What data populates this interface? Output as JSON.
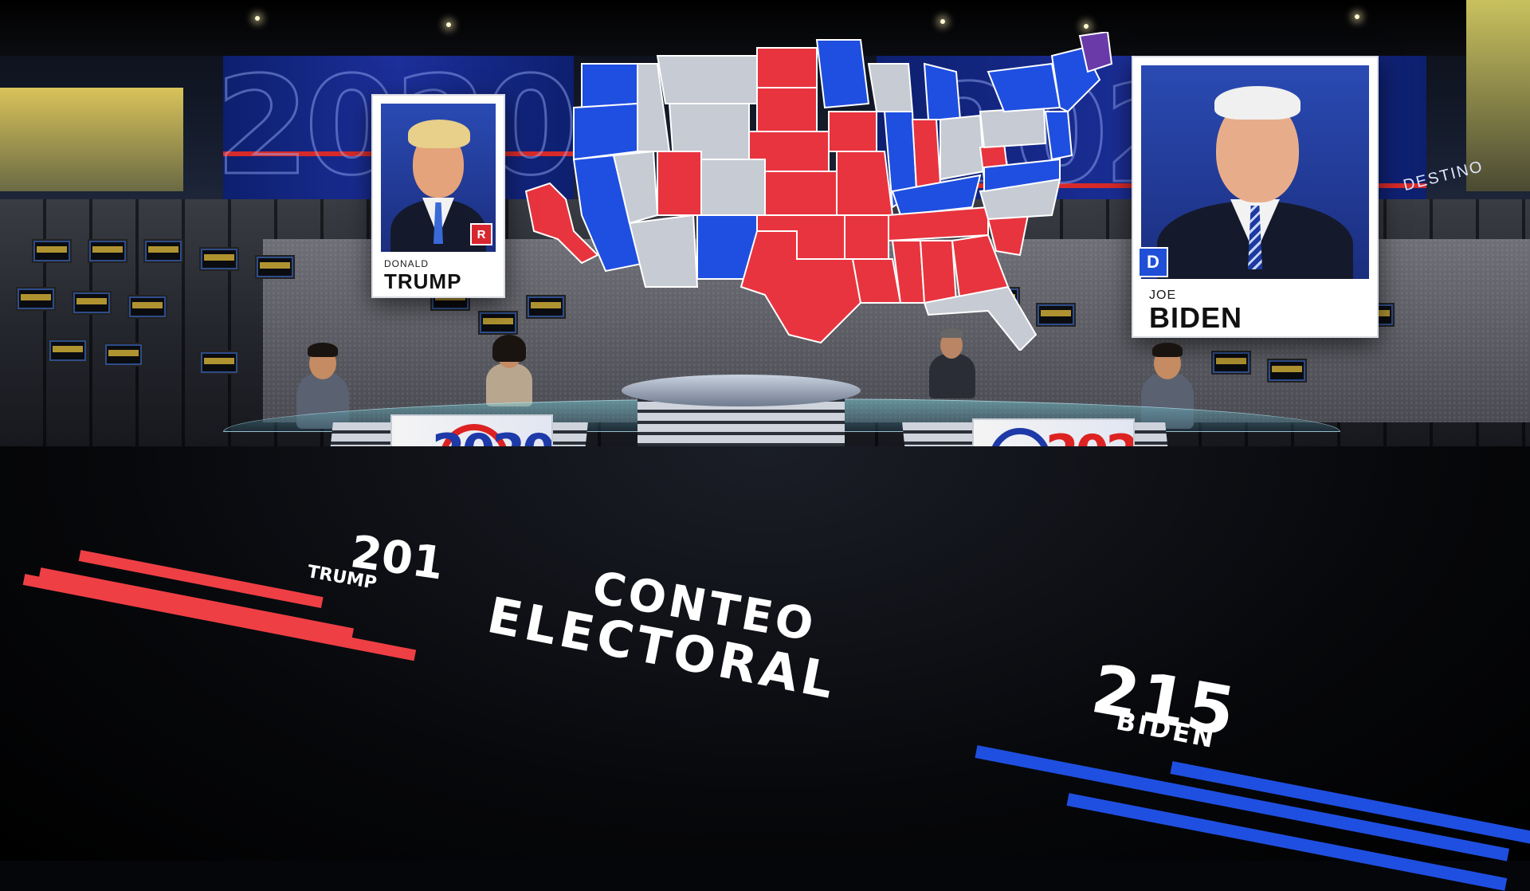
{
  "broadcast": {
    "title_line1": "CONTEO",
    "title_line2": "ELECTORAL",
    "wall_branding": "DESTINO",
    "wall_year": "2020"
  },
  "candidates": {
    "republican": {
      "first_name": "DONALD",
      "last_name": "TRUMP",
      "party_letter": "R",
      "party_color": "#d8262f",
      "electoral_votes": "201",
      "floor_label": "TRUMP"
    },
    "democrat": {
      "first_name": "JOE",
      "last_name": "BIDEN",
      "party_letter": "D",
      "party_color": "#1e4fd6",
      "electoral_votes": "215",
      "floor_label": "BIDEN"
    }
  },
  "colors": {
    "republican_red": "#e8343e",
    "democrat_blue": "#1f4fe0",
    "undecided_gray": "#c7cbd3",
    "split_purple": "#6a3aa8"
  }
}
